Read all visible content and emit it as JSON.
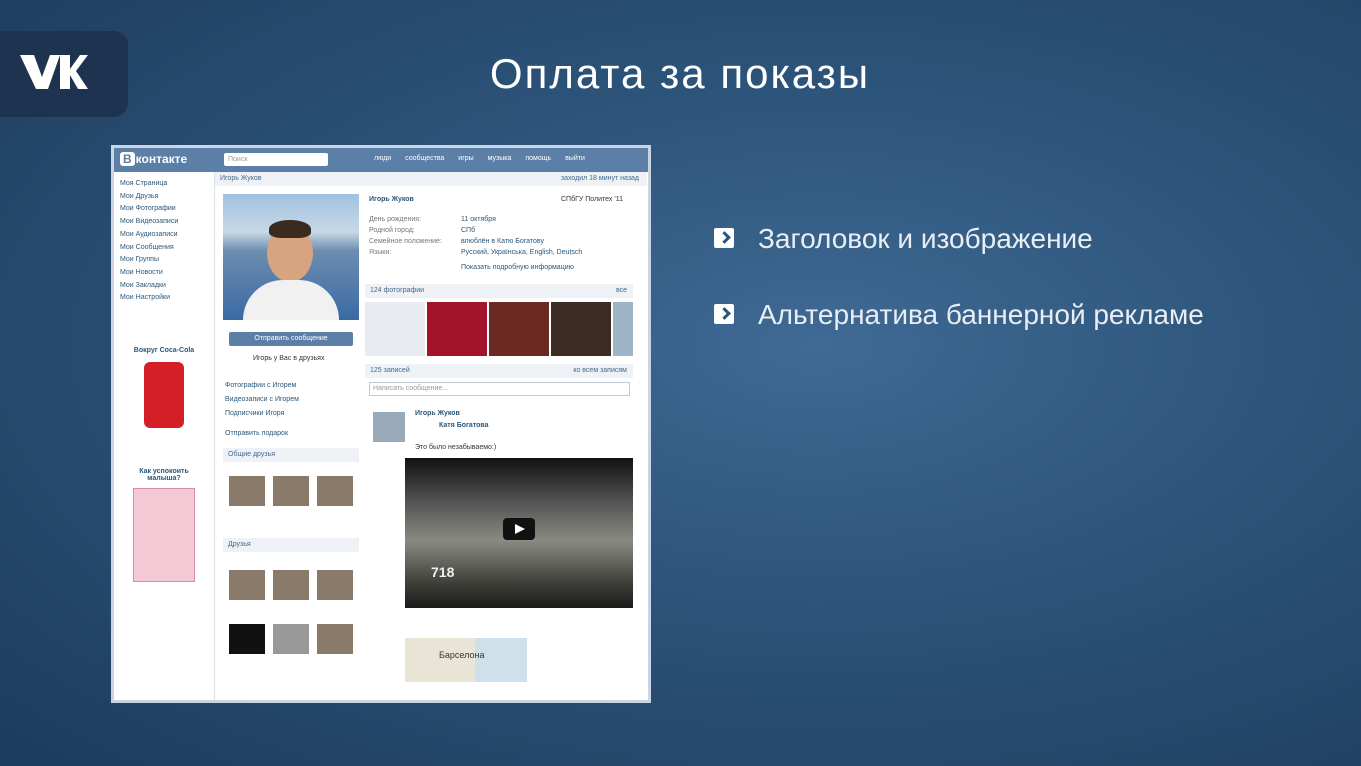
{
  "slide": {
    "title": "Оплата за показы",
    "bullets": [
      "Заголовок и изображение",
      "Альтернатива баннерной рекламе"
    ]
  },
  "vk": {
    "brand": "контакте",
    "brand_badge": "В",
    "search_placeholder": "Поиск",
    "nav": [
      "люди",
      "сообщества",
      "игры",
      "музыка",
      "помощь",
      "выйти"
    ],
    "left_menu": [
      "Моя Страница",
      "Мои Друзья",
      "Мои Фотографии",
      "Мои Видеозаписи",
      "Мои Аудиозаписи",
      "Мои Сообщения",
      "Мои Группы",
      "Мои Новости",
      "Мои Закладки",
      "Мои Настройки"
    ],
    "ad1_title": "Вокруг Coca-Cola",
    "ad2_title": "Как успокоить малыша?",
    "profile_name": "Игорь Жуков",
    "profile_name_header": "Игорь Жуков",
    "status_right": "заходил 18 минут назад",
    "university": "СПбГУ Политех '11",
    "info": [
      [
        "День рождения:",
        "11 октября"
      ],
      [
        "Родной город:",
        "СПб"
      ],
      [
        "Семейное положение:",
        "влюблён в Катю Богатову"
      ],
      [
        "Языки:",
        "Русский, Українська, English, Deutsch"
      ]
    ],
    "show_more": "Показать подробную информацию",
    "send_message": "Отправить сообщение",
    "in_friends": "Игорь у Вас в друзьях",
    "photos_header": "124 фотографии",
    "photos_all": "все",
    "wall_header": "125 записей",
    "wall_all": "ко всем записям",
    "wall_placeholder": "Написать сообщение...",
    "post_author": "Игорь Жуков",
    "post_sub": "Катя Богатова",
    "post_text": "Это было незабываемо:)",
    "video_number": "718",
    "map_label": "Барселона",
    "left_links": [
      "Фотографии с Игорем",
      "Видеозаписи с Игорем",
      "Подписчики Игоря",
      "Отправить подарок"
    ],
    "common_friends": "Общие друзья",
    "friends_header": "Друзья"
  }
}
